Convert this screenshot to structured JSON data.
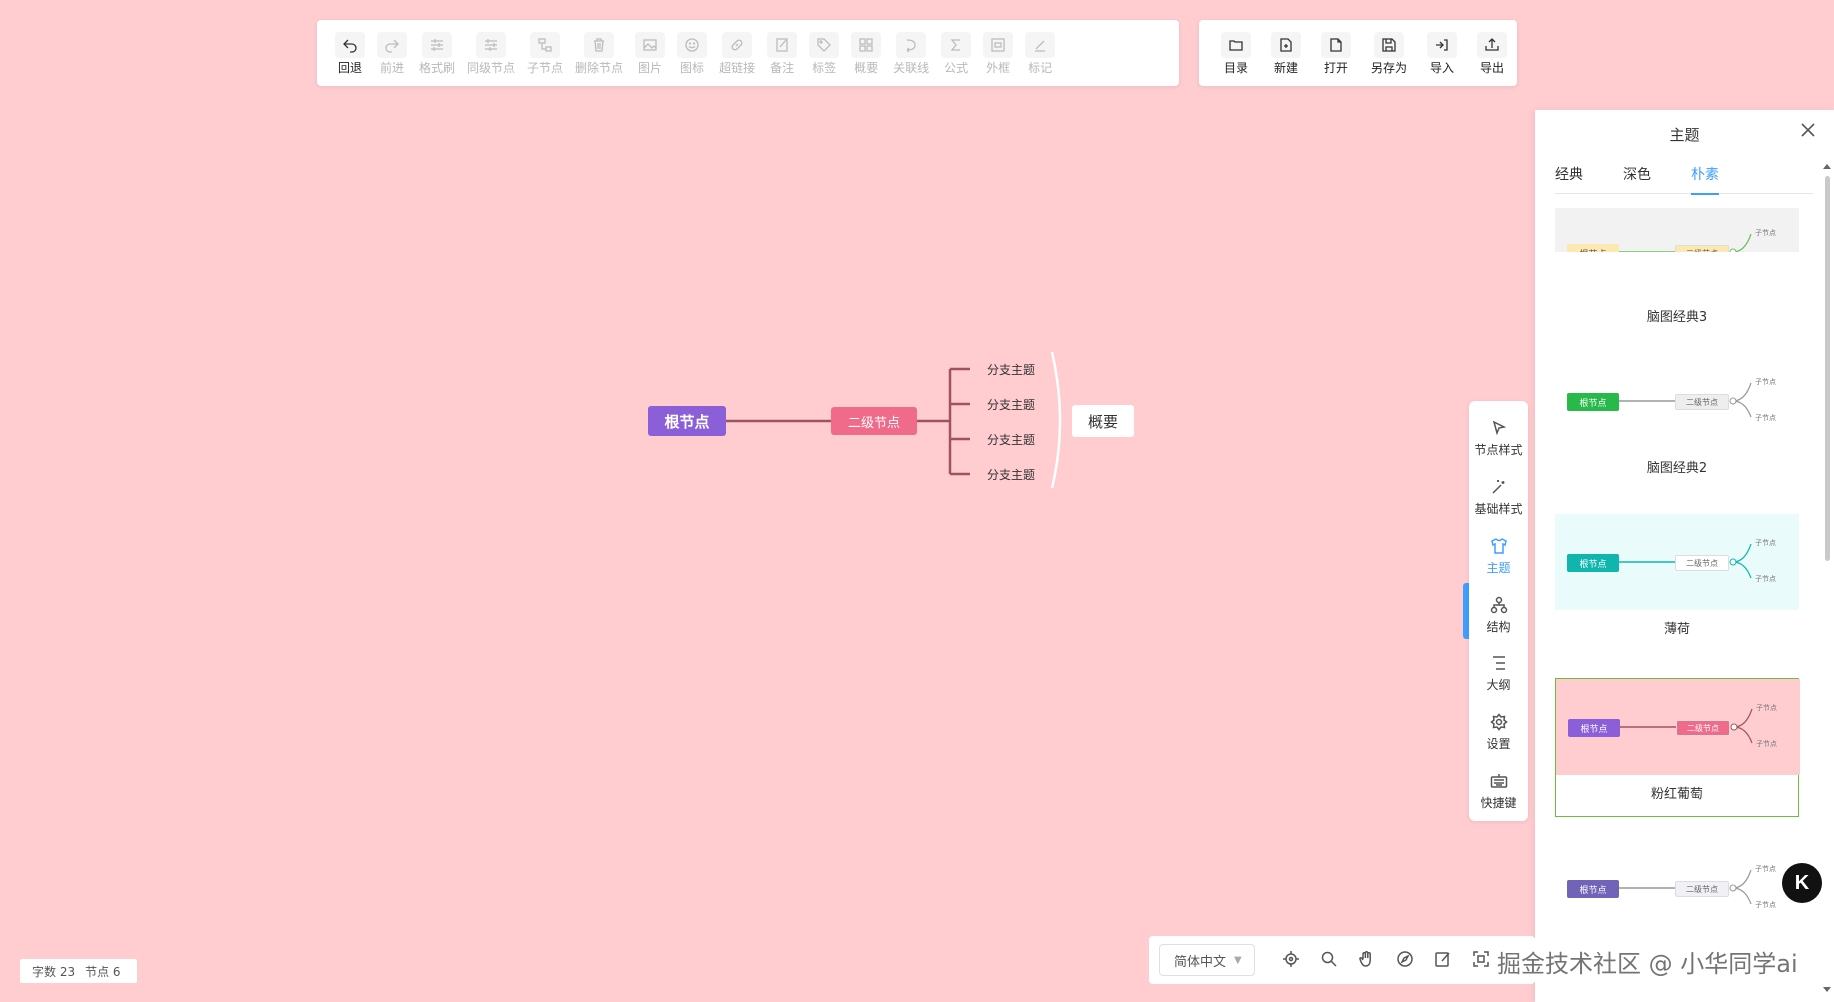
{
  "toolbar_edit": [
    {
      "label": "回退",
      "icon": "undo-icon",
      "enabled": true
    },
    {
      "label": "前进",
      "icon": "redo-icon",
      "enabled": false
    },
    {
      "label": "格式刷",
      "icon": "format-brush-icon",
      "enabled": false
    },
    {
      "label": "同级节点",
      "icon": "sibling-node-icon",
      "enabled": false
    },
    {
      "label": "子节点",
      "icon": "child-node-icon",
      "enabled": false
    },
    {
      "label": "删除节点",
      "icon": "trash-icon",
      "enabled": false
    },
    {
      "label": "图片",
      "icon": "image-icon",
      "enabled": false
    },
    {
      "label": "图标",
      "icon": "smiley-icon",
      "enabled": false
    },
    {
      "label": "超链接",
      "icon": "link-icon",
      "enabled": false
    },
    {
      "label": "备注",
      "icon": "note-icon",
      "enabled": false
    },
    {
      "label": "标签",
      "icon": "tag-icon",
      "enabled": false
    },
    {
      "label": "概要",
      "icon": "summary-icon",
      "enabled": false
    },
    {
      "label": "关联线",
      "icon": "association-line-icon",
      "enabled": false
    },
    {
      "label": "公式",
      "icon": "formula-icon",
      "enabled": false
    },
    {
      "label": "外框",
      "icon": "outer-frame-icon",
      "enabled": false
    },
    {
      "label": "标记",
      "icon": "mark-icon",
      "enabled": false
    }
  ],
  "toolbar_file": [
    {
      "label": "目录",
      "icon": "folder-icon"
    },
    {
      "label": "新建",
      "icon": "new-file-icon"
    },
    {
      "label": "打开",
      "icon": "open-file-icon"
    },
    {
      "label": "另存为",
      "icon": "save-as-icon"
    },
    {
      "label": "导入",
      "icon": "import-icon"
    },
    {
      "label": "导出",
      "icon": "export-icon"
    }
  ],
  "mindmap": {
    "root": "根节点",
    "second": "二级节点",
    "branches": [
      "分支主题",
      "分支主题",
      "分支主题",
      "分支主题"
    ],
    "summary": "概要",
    "line_color": "#a0535f"
  },
  "side_toolbar": [
    {
      "label": "节点样式",
      "icon": "node-style-icon",
      "active": false
    },
    {
      "label": "基础样式",
      "icon": "magic-wand-icon",
      "active": false
    },
    {
      "label": "主题",
      "icon": "tshirt-icon",
      "active": true
    },
    {
      "label": "结构",
      "icon": "structure-icon",
      "active": false
    },
    {
      "label": "大纲",
      "icon": "outline-icon",
      "active": false
    },
    {
      "label": "设置",
      "icon": "settings-icon",
      "active": false
    },
    {
      "label": "快捷键",
      "icon": "keyboard-icon",
      "active": false
    }
  ],
  "theme_panel": {
    "title": "主题",
    "tabs": [
      "经典",
      "深色",
      "朴素"
    ],
    "active_tab": "朴素",
    "themes": [
      {
        "name": "脑图经典3",
        "bg": "#f2f2f2",
        "root": "根节点",
        "second": "二级节点",
        "child": "子节点",
        "root_color": "#fde8b0",
        "second_color": "#fde8b0",
        "line": "#6cc05a"
      },
      {
        "name": "脑图经典2",
        "bg": "#ffffff",
        "root": "根节点",
        "second": "二级节点",
        "child": "子节点",
        "root_color": "#27b94a",
        "second_color": "#eeeeee",
        "line": "#999999"
      },
      {
        "name": "薄荷",
        "bg": "#e9fcfb",
        "root": "根节点",
        "second": "二级节点",
        "child": "子节点",
        "root_color": "#10b6ad",
        "second_color": "#ffffff",
        "line": "#10b6ad"
      },
      {
        "name": "粉红葡萄",
        "bg": "#ffccd0",
        "root": "根节点",
        "second": "二级节点",
        "child": "子节点",
        "root_color": "#8a5fd8",
        "second_color": "#f06a8a",
        "line": "#a0535f"
      },
      {
        "name": "",
        "bg": "#ffffff",
        "root": "根节点",
        "second": "二级节点",
        "child": "子节点",
        "root_color": "#7164b8",
        "second_color": "#f0f0f5",
        "line": "#999999"
      }
    ]
  },
  "bottom_toolbar": {
    "language": "简体中文",
    "icons": [
      "locate-icon",
      "search-icon",
      "hand-icon",
      "navigator-icon",
      "edit-icon",
      "fullscreen-icon"
    ]
  },
  "status": {
    "word_count": "字数 23",
    "node_count": "节点 6"
  },
  "watermark": "掘金技术社区 @ 小华同学ai",
  "avatar": "K"
}
